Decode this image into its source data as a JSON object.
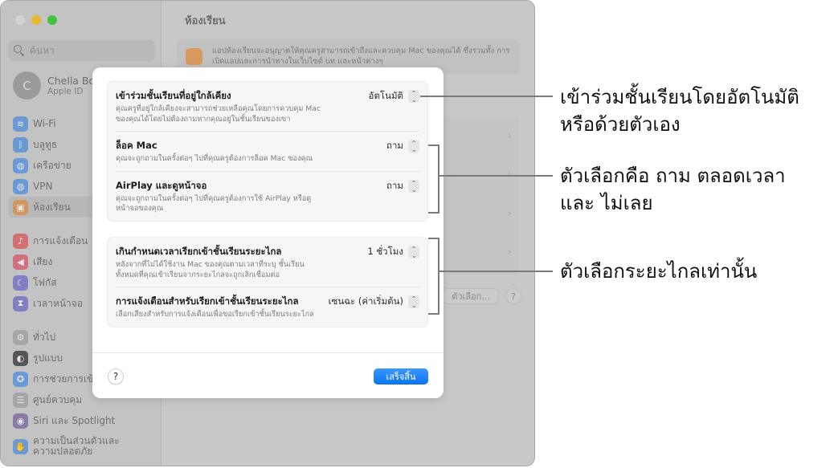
{
  "window": {
    "title": "ห้องเรียน",
    "search_placeholder": "ค้นหา",
    "account": {
      "initial": "C",
      "name": "Chella Boehm",
      "subtitle": "Apple ID"
    },
    "sidebar": {
      "group1": [
        {
          "label": "Wi-Fi",
          "icon": "wifi-icon",
          "color": "#6a9ad6",
          "glyph": "≋"
        },
        {
          "label": "บลูทูธ",
          "icon": "bluetooth-icon",
          "color": "#6a9ad6",
          "glyph": "ᛒ"
        },
        {
          "label": "เครือข่าย",
          "icon": "network-icon",
          "color": "#6a9ad6",
          "glyph": "◍"
        },
        {
          "label": "VPN",
          "icon": "vpn-icon",
          "color": "#6a9ad6",
          "glyph": "◍"
        },
        {
          "label": "ห้องเรียน",
          "icon": "classroom-icon",
          "color": "#d0955c",
          "glyph": "▣",
          "active": true
        }
      ],
      "group2": [
        {
          "label": "การแจ้งเตือน",
          "icon": "notifications-icon",
          "color": "#d07070",
          "glyph": "♪"
        },
        {
          "label": "เสียง",
          "icon": "sound-icon",
          "color": "#d07080",
          "glyph": "◀"
        },
        {
          "label": "โฟกัส",
          "icon": "focus-icon",
          "color": "#7f7fc4",
          "glyph": "☾"
        },
        {
          "label": "เวลาหน้าจอ",
          "icon": "screen-time-icon",
          "color": "#7f7fc4",
          "glyph": "⧗"
        }
      ],
      "group3": [
        {
          "label": "ทั่วไป",
          "icon": "general-icon",
          "color": "#a6a6a6",
          "glyph": "⚙"
        },
        {
          "label": "รูปแบบ",
          "icon": "appearance-icon",
          "color": "#555555",
          "glyph": "◐"
        },
        {
          "label": "การช่วยการเข้าถึง",
          "icon": "accessibility-icon",
          "color": "#6a9ad6",
          "glyph": "✪"
        },
        {
          "label": "ศูนย์ควบคุม",
          "icon": "control-center-icon",
          "color": "#a6a6a6",
          "glyph": "☰"
        },
        {
          "label": "Siri และ Spotlight",
          "icon": "siri-icon",
          "color": "#8a7aa6",
          "glyph": "◉"
        },
        {
          "label": "ความเป็นส่วนตัวและความปลอดภัย",
          "icon": "privacy-icon",
          "color": "#6a9ad6",
          "glyph": "✋",
          "tall": true
        }
      ]
    },
    "info_text": "แอปห้องเรียนจะอนุญาตให้คุณครูสามารถเข้าถึงและควบคุม Mac ของคุณได้ ซึ่งรวมทั้ง การเปิดแอปและการนำทางในเว็บไซต์ บท และหน้าต่างๆ",
    "options_button": "ตัวเลือก...",
    "help_button": "?"
  },
  "dialog": {
    "groups": [
      {
        "rows": [
          {
            "title": "เข้าร่วมชั้นเรียนที่อยู่ใกล้เคียง",
            "desc": "คุณครูที่อยู่ใกล้เคียงจะสามารถช่วยเหลือคุณโดยการควบคุม Mac ของคุณได้โดยไม่ต้องถามหากคุณอยู่ในชั้นเรียนของเขา",
            "value": "อัตโนมัติ"
          },
          {
            "title": "ล็อค Mac",
            "desc": "คุณจะถูกถามในครั้งต่อๆ ไปที่คุณครูต้องการล็อค Mac ของคุณ",
            "value": "ถาม"
          },
          {
            "title": "AirPlay และดูหน้าจอ",
            "desc": "คุณจะถูกถามในครั้งต่อๆ ไปที่คุณครูต้องการใช้ AirPlay หรือดูหน้าจอของคุณ",
            "value": "ถาม"
          }
        ]
      },
      {
        "rows": [
          {
            "title": "เกินกำหนดเวลาเรียกเข้าชั้นเรียนระยะไกล",
            "desc": "หลังจากที่ไม่ได้ใช้งาน Mac ของคุณตามเวลาที่ระบุ ชั้นเรียนทั้งหมดที่คุณเข้าเรียนจากระยะไกลจะถูกเลิกเชื่อมต่อ",
            "value": "1 ชั่วโมง"
          },
          {
            "title": "การแจ้งเตือนสำหรับเรียกเข้าชั้นเรียนระยะไกล",
            "desc": "เลือกเสียงสำหรับการแจ้งเตือนเพื่อขอเรียกเข้าชั้นเรียนระยะไกล",
            "value": "เซนฉะ (ค่าเริ่มต้น)"
          }
        ]
      }
    ],
    "help_button": "?",
    "done_button": "เสร็จสิ้น",
    "accent_color": "#0a74f0"
  },
  "callouts": [
    {
      "text": "เข้าร่วมชั้นเรียนโดยอัตโนมัติ หรือด้วยตัวเอง"
    },
    {
      "text": "ตัวเลือกคือ ถาม ตลอดเวลา และ ไม่เลย"
    },
    {
      "text": "ตัวเลือกระยะไกลเท่านั้น"
    }
  ]
}
